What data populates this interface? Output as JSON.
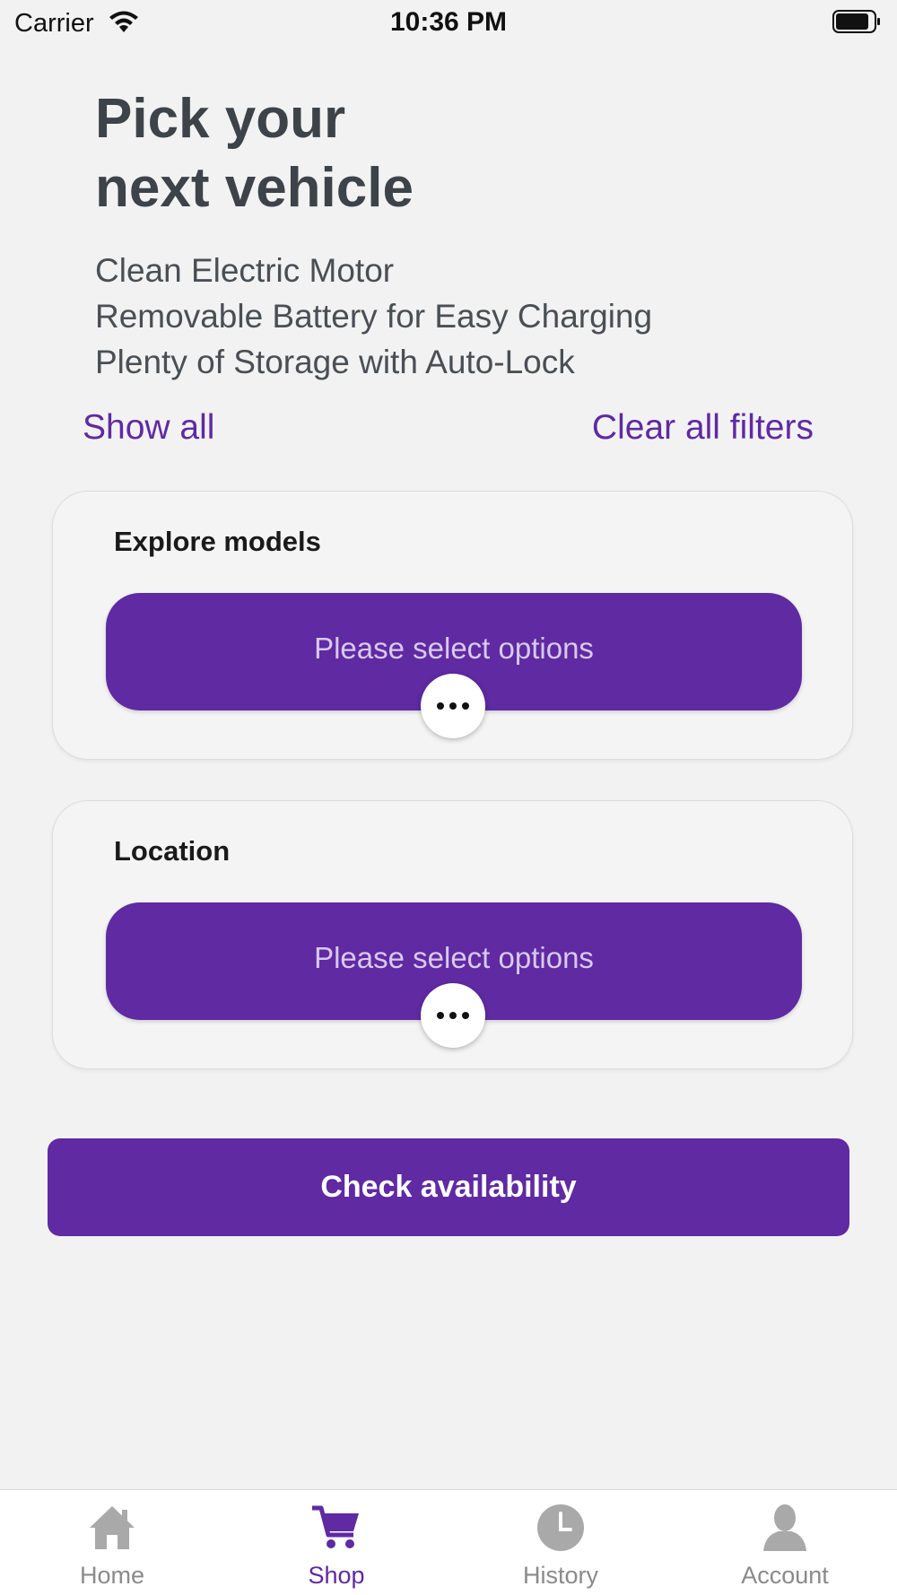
{
  "status_bar": {
    "carrier": "Carrier",
    "time": "10:36 PM",
    "icons": [
      "wifi-icon",
      "battery-icon"
    ]
  },
  "header": {
    "title_line1": "Pick your",
    "title_line2": "next vehicle",
    "features": [
      "Clean Electric Motor",
      "Removable Battery for Easy Charging",
      "Plenty of Storage with Auto-Lock"
    ]
  },
  "filters": {
    "show_all": "Show all",
    "clear_all": "Clear all filters"
  },
  "cards": [
    {
      "title": "Explore models",
      "select_label": "Please select options",
      "more_icon": "ellipsis-icon"
    },
    {
      "title": "Location",
      "select_label": "Please select options",
      "more_icon": "ellipsis-icon"
    }
  ],
  "actions": {
    "check_availability": "Check availability"
  },
  "tab_bar": {
    "active": "Shop",
    "tabs": [
      {
        "label": "Home",
        "icon": "home-icon"
      },
      {
        "label": "Shop",
        "icon": "cart-icon"
      },
      {
        "label": "History",
        "icon": "clock-icon"
      },
      {
        "label": "Account",
        "icon": "user-icon"
      }
    ]
  },
  "colors": {
    "accent": "#5f2aa2",
    "background": "#f2f2f2",
    "heading": "#3d4348",
    "tab_inactive": "#8a8a8a"
  }
}
